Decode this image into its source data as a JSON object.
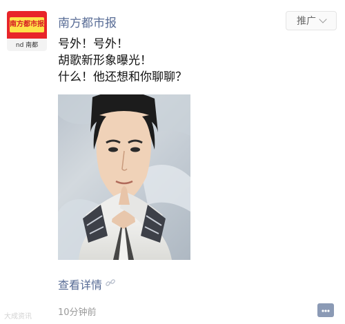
{
  "account": {
    "name": "南方都市报",
    "avatar_logo_text": "南方都市报",
    "avatar_sub_text": "nd 南都"
  },
  "promo_badge": {
    "label": "推广",
    "icon": "chevron-down-icon"
  },
  "post": {
    "lines": [
      "号外！号外！",
      "胡歌新形象曝光！",
      "什么！他还想和你聊聊？"
    ]
  },
  "read_more": {
    "label": "查看详情",
    "icon": "link-icon"
  },
  "timestamp": "10分钟前",
  "comment_button_icon": "comment-icon",
  "watermark": "大成资讯",
  "colors": {
    "link": "#576b95",
    "timestamp": "#999999",
    "brand_red": "#e8252a",
    "brand_yellow": "#ffe14a"
  }
}
